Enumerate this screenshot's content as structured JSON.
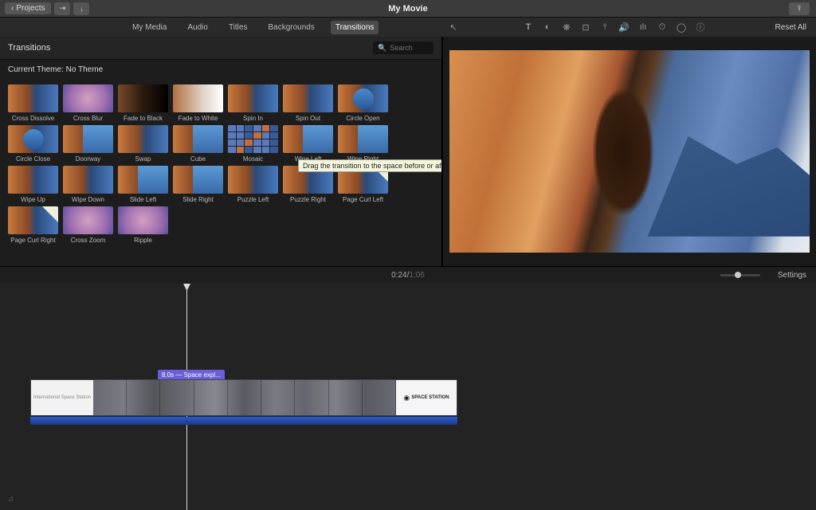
{
  "topbar": {
    "projects_label": "Projects",
    "title": "My Movie"
  },
  "tabs": {
    "items": [
      "My Media",
      "Audio",
      "Titles",
      "Backgrounds",
      "Transitions"
    ],
    "active": "Transitions"
  },
  "preview_tools": {
    "reset_label": "Reset All"
  },
  "browser": {
    "title": "Transitions",
    "search_placeholder": "Search",
    "theme_label": "Current Theme: No Theme"
  },
  "transitions": [
    {
      "label": "Cross Dissolve",
      "style": ""
    },
    {
      "label": "Cross Blur",
      "style": "blur"
    },
    {
      "label": "Fade to Black",
      "style": "dark"
    },
    {
      "label": "Fade to White",
      "style": "white"
    },
    {
      "label": "Spin In",
      "style": ""
    },
    {
      "label": "Spin Out",
      "style": ""
    },
    {
      "label": "Circle Open",
      "style": "circle"
    },
    {
      "label": "Circle Close",
      "style": "circle"
    },
    {
      "label": "Doorway",
      "style": "slide"
    },
    {
      "label": "Swap",
      "style": ""
    },
    {
      "label": "Cube",
      "style": "slide"
    },
    {
      "label": "Mosaic",
      "style": "mosaic"
    },
    {
      "label": "Wipe Left",
      "style": "slide"
    },
    {
      "label": "Wipe Right",
      "style": "slide"
    },
    {
      "label": "Wipe Up",
      "style": ""
    },
    {
      "label": "Wipe Down",
      "style": ""
    },
    {
      "label": "Slide Left",
      "style": "slide"
    },
    {
      "label": "Slide Right",
      "style": "slide"
    },
    {
      "label": "Puzzle Left",
      "style": ""
    },
    {
      "label": "Puzzle Right",
      "style": ""
    },
    {
      "label": "Page Curl Left",
      "style": "curl"
    },
    {
      "label": "Page Curl Right",
      "style": "curl"
    },
    {
      "label": "Cross Zoom",
      "style": "blur"
    },
    {
      "label": "Ripple",
      "style": "blur"
    }
  ],
  "tooltip": "Drag the transition to the space before or after a clip",
  "timebar": {
    "current": "0:24",
    "total": "1:06",
    "separator": " / ",
    "settings_label": "Settings"
  },
  "timeline": {
    "audio_marker": "8.0s — Space expl...",
    "title_clip": "International Space Station",
    "end_clip_logo": "SPACE STATION",
    "music_icon": "♫"
  }
}
